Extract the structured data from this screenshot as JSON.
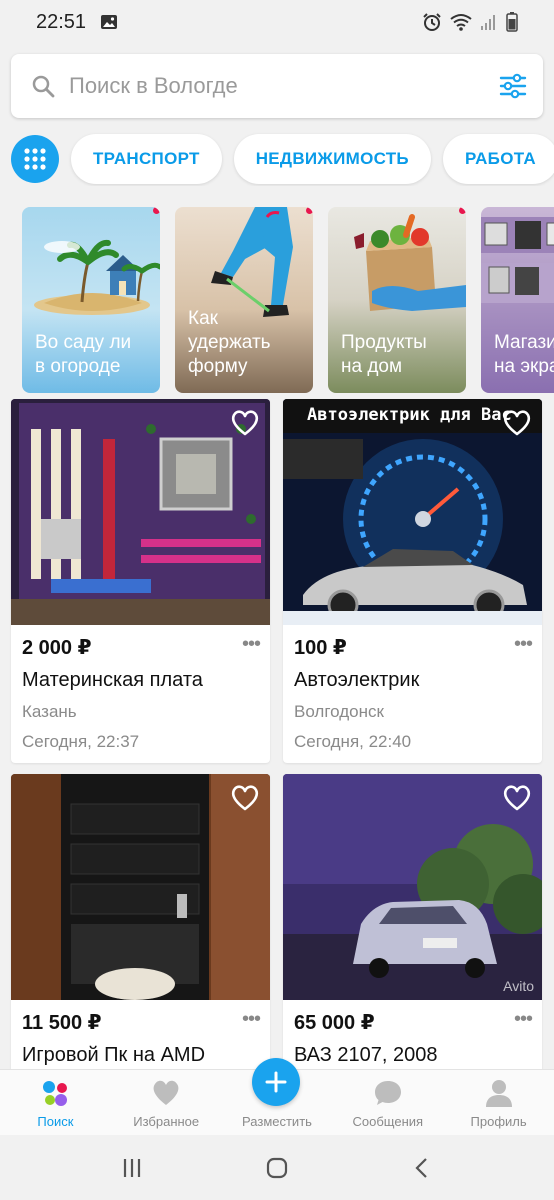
{
  "status_bar": {
    "time": "22:51"
  },
  "search": {
    "placeholder": "Поиск в Вологде"
  },
  "categories": [
    "ТРАНСПОРТ",
    "НЕДВИЖИМОСТЬ",
    "РАБОТА"
  ],
  "stories": [
    {
      "label": "Во саду ли\nв огороде"
    },
    {
      "label": "Как\nудержать\nформу"
    },
    {
      "label": "Продукты\nна дом"
    },
    {
      "label": "Магазин\nна экра"
    }
  ],
  "listings": [
    {
      "price": "2 000 ₽",
      "title": "Материнская плата",
      "city": "Казань",
      "time": "Сегодня, 22:37",
      "photo_text": ""
    },
    {
      "price": "100 ₽",
      "title": "Автоэлектрик",
      "city": "Волгодонск",
      "time": "Сегодня, 22:40",
      "photo_text": "Автоэлектрик для Вас"
    },
    {
      "price": "11 500 ₽",
      "title": "Игровой Пк на AMD",
      "city": "",
      "time": ""
    },
    {
      "price": "65 000 ₽",
      "title": "ВАЗ 2107, 2008",
      "city": "",
      "time": "",
      "watermark": "Avito"
    }
  ],
  "tabbar": {
    "search": "Поиск",
    "favorites": "Избранное",
    "post": "Разместить",
    "messages": "Сообщения",
    "profile": "Профиль"
  },
  "colors": {
    "accent": "#1aa3ee",
    "chip_text": "#0a9be8",
    "story_dot": "#e8174e"
  }
}
